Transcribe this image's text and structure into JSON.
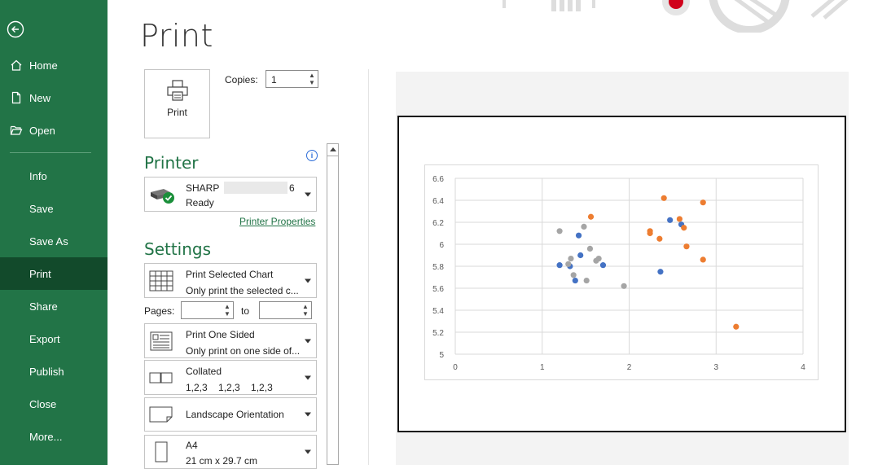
{
  "nav": {
    "items": [
      {
        "label": "Home",
        "icon": "home-icon"
      },
      {
        "label": "New",
        "icon": "new-document-icon"
      },
      {
        "label": "Open",
        "icon": "folder-open-icon"
      },
      {
        "label": "Info"
      },
      {
        "label": "Save"
      },
      {
        "label": "Save As"
      },
      {
        "label": "Print",
        "active": true
      },
      {
        "label": "Share"
      },
      {
        "label": "Export"
      },
      {
        "label": "Publish"
      },
      {
        "label": "Close"
      },
      {
        "label": "More..."
      }
    ]
  },
  "page_title": "Print",
  "print_button": {
    "label": "Print"
  },
  "copies": {
    "label": "Copies:",
    "value": "1"
  },
  "printer": {
    "heading": "Printer",
    "name": "SHARP",
    "name_suffix": "6",
    "status": "Ready",
    "properties_link": "Printer Properties"
  },
  "settings": {
    "heading": "Settings",
    "what": {
      "title": "Print Selected Chart",
      "subtitle": "Only print the selected c..."
    },
    "pages": {
      "label": "Pages:",
      "to_label": "to",
      "from": "",
      "to": ""
    },
    "sides": {
      "title": "Print One Sided",
      "subtitle": "Only print on one side of..."
    },
    "collation": {
      "title": "Collated",
      "subtitle": "1,2,3    1,2,3    1,2,3"
    },
    "orientation": {
      "title": "Landscape Orientation"
    },
    "paper": {
      "title": "A4",
      "subtitle": "21 cm x 29.7 cm"
    }
  },
  "colors": {
    "brand": "#227447",
    "brand_dark": "#124a2b",
    "series_blue": "#4472c4",
    "series_orange": "#ed7d31",
    "series_gray": "#a5a5a5"
  },
  "chart_data": {
    "type": "scatter",
    "xlim": [
      0,
      4
    ],
    "ylim": [
      5,
      6.6
    ],
    "x_ticks": [
      0,
      1,
      2,
      3,
      4
    ],
    "y_ticks": [
      5,
      5.2,
      5.4,
      5.6,
      5.8,
      6,
      6.2,
      6.4,
      6.6
    ],
    "grid": true,
    "series": [
      {
        "color": "#4472c4",
        "points": [
          [
            1.2,
            5.81
          ],
          [
            1.32,
            5.8
          ],
          [
            1.38,
            5.67
          ],
          [
            1.42,
            6.08
          ],
          [
            1.44,
            5.9
          ],
          [
            1.7,
            5.81
          ],
          [
            2.36,
            5.75
          ],
          [
            2.47,
            6.22
          ],
          [
            2.6,
            6.18
          ]
        ]
      },
      {
        "color": "#ed7d31",
        "points": [
          [
            1.56,
            6.25
          ],
          [
            2.24,
            6.12
          ],
          [
            2.24,
            6.1
          ],
          [
            2.35,
            6.05
          ],
          [
            2.4,
            6.42
          ],
          [
            2.58,
            6.23
          ],
          [
            2.63,
            6.15
          ],
          [
            2.66,
            5.98
          ],
          [
            2.85,
            6.38
          ],
          [
            2.85,
            5.86
          ],
          [
            3.23,
            5.25
          ]
        ]
      },
      {
        "color": "#a5a5a5",
        "points": [
          [
            1.2,
            6.12
          ],
          [
            1.3,
            5.82
          ],
          [
            1.33,
            5.87
          ],
          [
            1.36,
            5.72
          ],
          [
            1.48,
            6.16
          ],
          [
            1.51,
            5.67
          ],
          [
            1.55,
            5.96
          ],
          [
            1.62,
            5.85
          ],
          [
            1.65,
            5.87
          ],
          [
            1.94,
            5.62
          ]
        ]
      }
    ]
  }
}
